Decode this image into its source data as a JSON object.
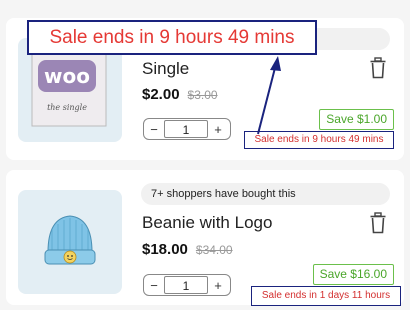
{
  "items": [
    {
      "title": "Single",
      "price": "$2.00",
      "old_price": "$3.00",
      "quantity": "1",
      "save": "Save $1.00",
      "sale_notice": "Sale ends in 9 hours 49 mins",
      "shoppers_text": "",
      "image_text": "woo",
      "image_subtext": "the single"
    },
    {
      "title": "Beanie with Logo",
      "price": "$18.00",
      "old_price": "$34.00",
      "quantity": "1",
      "save": "Save $16.00",
      "sale_notice": "Sale ends in 1 days 11 hours",
      "shoppers_text": "7+ shoppers have bought this"
    }
  ],
  "callout": {
    "text": "Sale ends in 9 hours 49 mins"
  },
  "stepper": {
    "minus": "−",
    "plus": "+"
  },
  "colors": {
    "sale_red": "#d32f2f",
    "save_green": "#4aa62a",
    "callout_border": "#1a237e"
  },
  "icons": [
    "trash-icon",
    "minus-icon",
    "plus-icon",
    "woo-album-image",
    "beanie-image"
  ]
}
